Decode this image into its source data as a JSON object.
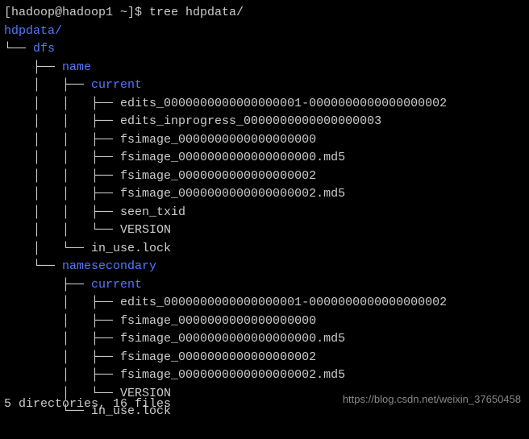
{
  "prompt": {
    "user_host": "[hadoop@hadoop1 ~]$ ",
    "command": "tree hdpdata/"
  },
  "tree": {
    "root": "hdpdata/",
    "dfs": "dfs",
    "name": "name",
    "namesecondary": "namesecondary",
    "current": "current",
    "name_files": {
      "edits1": "edits_0000000000000000001-0000000000000000002",
      "edits_inprogress": "edits_inprogress_0000000000000000003",
      "fsimage0": "fsimage_0000000000000000000",
      "fsimage0_md5": "fsimage_0000000000000000000.md5",
      "fsimage2": "fsimage_0000000000000000002",
      "fsimage2_md5": "fsimage_0000000000000000002.md5",
      "seen_txid": "seen_txid",
      "version": "VERSION",
      "in_use_lock": "in_use.lock"
    },
    "secondary_files": {
      "edits1": "edits_0000000000000000001-0000000000000000002",
      "fsimage0": "fsimage_0000000000000000000",
      "fsimage0_md5": "fsimage_0000000000000000000.md5",
      "fsimage2": "fsimage_0000000000000000002",
      "fsimage2_md5": "fsimage_0000000000000000002.md5",
      "version": "VERSION",
      "in_use_lock": "in_use.lock"
    }
  },
  "summary": "5 directories, 16 files",
  "watermark": "https://blog.csdn.net/weixin_37650458"
}
